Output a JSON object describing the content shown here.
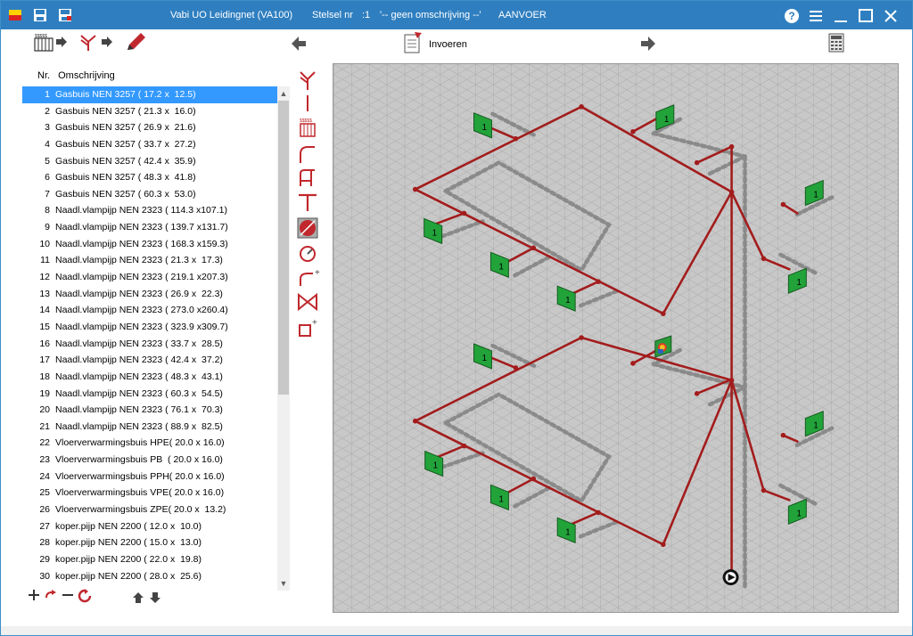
{
  "window": {
    "title": "Vabi UO Leidingnet (VA100)",
    "stelsel_label": "Stelsel nr",
    "stelsel_value": ":1",
    "omschrijving": "'-- geen omschrijving --'",
    "mode": "AANVOER"
  },
  "toolbar": {
    "invoeren_label": "Invoeren"
  },
  "list": {
    "col_nr": "Nr.",
    "col_desc": "Omschrijving",
    "rows": [
      {
        "nr": "1",
        "desc": "Gasbuis NEN 3257 ( 17.2 x  12.5)"
      },
      {
        "nr": "2",
        "desc": "Gasbuis NEN 3257 ( 21.3 x  16.0)"
      },
      {
        "nr": "3",
        "desc": "Gasbuis NEN 3257 ( 26.9 x  21.6)"
      },
      {
        "nr": "4",
        "desc": "Gasbuis NEN 3257 ( 33.7 x  27.2)"
      },
      {
        "nr": "5",
        "desc": "Gasbuis NEN 3257 ( 42.4 x  35.9)"
      },
      {
        "nr": "6",
        "desc": "Gasbuis NEN 3257 ( 48.3 x  41.8)"
      },
      {
        "nr": "7",
        "desc": "Gasbuis NEN 3257 ( 60.3 x  53.0)"
      },
      {
        "nr": "8",
        "desc": "Naadl.vlampijp NEN 2323 ( 114.3 x107.1)"
      },
      {
        "nr": "9",
        "desc": "Naadl.vlampijp NEN 2323 ( 139.7 x131.7)"
      },
      {
        "nr": "10",
        "desc": "Naadl.vlampijp NEN 2323 ( 168.3 x159.3)"
      },
      {
        "nr": "11",
        "desc": "Naadl.vlampijp NEN 2323 ( 21.3 x  17.3)"
      },
      {
        "nr": "12",
        "desc": "Naadl.vlampijp NEN 2323 ( 219.1 x207.3)"
      },
      {
        "nr": "13",
        "desc": "Naadl.vlampijp NEN 2323 ( 26.9 x  22.3)"
      },
      {
        "nr": "14",
        "desc": "Naadl.vlampijp NEN 2323 ( 273.0 x260.4)"
      },
      {
        "nr": "15",
        "desc": "Naadl.vlampijp NEN 2323 ( 323.9 x309.7)"
      },
      {
        "nr": "16",
        "desc": "Naadl.vlampijp NEN 2323 ( 33.7 x  28.5)"
      },
      {
        "nr": "17",
        "desc": "Naadl.vlampijp NEN 2323 ( 42.4 x  37.2)"
      },
      {
        "nr": "18",
        "desc": "Naadl.vlampijp NEN 2323 ( 48.3 x  43.1)"
      },
      {
        "nr": "19",
        "desc": "Naadl.vlampijp NEN 2323 ( 60.3 x  54.5)"
      },
      {
        "nr": "20",
        "desc": "Naadl.vlampijp NEN 2323 ( 76.1 x  70.3)"
      },
      {
        "nr": "21",
        "desc": "Naadl.vlampijp NEN 2323 ( 88.9 x  82.5)"
      },
      {
        "nr": "22",
        "desc": "Vloerverwarmingsbuis HPE( 20.0 x 16.0)"
      },
      {
        "nr": "23",
        "desc": "Vloerverwarmingsbuis PB  ( 20.0 x 16.0)"
      },
      {
        "nr": "24",
        "desc": "Vloerverwarmingsbuis PPH( 20.0 x 16.0)"
      },
      {
        "nr": "25",
        "desc": "Vloerverwarmingsbuis VPE( 20.0 x 16.0)"
      },
      {
        "nr": "26",
        "desc": "Vloerverwarmingsbuis ZPE( 20.0 x  13.2)"
      },
      {
        "nr": "27",
        "desc": "koper.pijp NEN 2200 ( 12.0 x  10.0)"
      },
      {
        "nr": "28",
        "desc": "koper.pijp NEN 2200 ( 15.0 x  13.0)"
      },
      {
        "nr": "29",
        "desc": "koper.pijp NEN 2200 ( 22.0 x  19.8)"
      },
      {
        "nr": "30",
        "desc": "koper.pijp NEN 2200 ( 28.0 x  25.6)"
      }
    ]
  },
  "drawing": {
    "radiator_label": "1"
  },
  "colors": {
    "titlebar": "#2f7fc0",
    "selection": "#3399ff",
    "pipe_supply": "#a31c1c",
    "pipe_return": "#8a8a8a",
    "radiator": "#22a33a",
    "canvas": "#c8c8c8"
  },
  "icons": [
    "app-logo-icon",
    "save-icon",
    "save-as-icon",
    "help-icon",
    "menu-icon",
    "minimize-icon",
    "maximize-icon",
    "close-icon",
    "radiator-icon",
    "branch-icon",
    "pen-icon",
    "arrow-left-icon",
    "document-icon",
    "arrow-right-icon",
    "calculator-icon",
    "add-icon",
    "remove-icon",
    "refresh-icon",
    "move-up-icon",
    "move-down-icon",
    "pump-icon"
  ]
}
